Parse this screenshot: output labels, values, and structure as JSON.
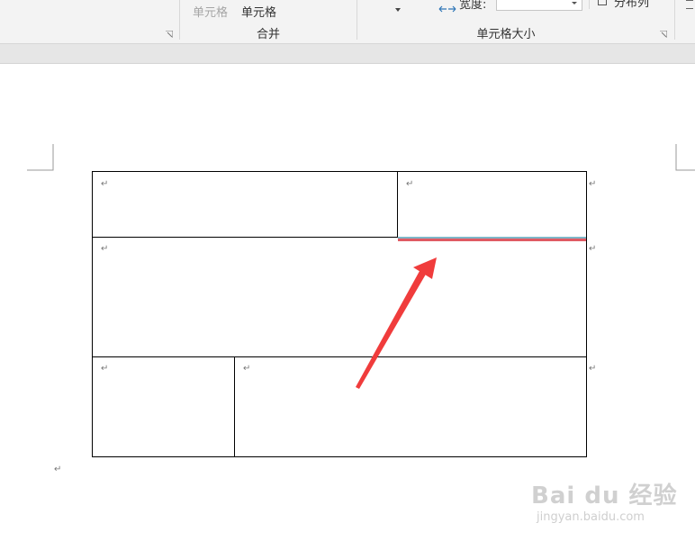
{
  "ribbon": {
    "merge_group": {
      "cell_label_dim": "单元格",
      "cell_label": "单元格",
      "label": "合并"
    },
    "cell_size_group": {
      "width_label": "宽度:",
      "distribute_cols": "分布列",
      "label": "单元格大小"
    }
  },
  "document": {
    "paragraph_mark": "↵"
  },
  "watermark": {
    "logo": "Bai du 经验",
    "url": "jingyan.baidu.com"
  },
  "colors": {
    "highlight_border": "#e05a63",
    "arrow": "#f03c3c"
  }
}
